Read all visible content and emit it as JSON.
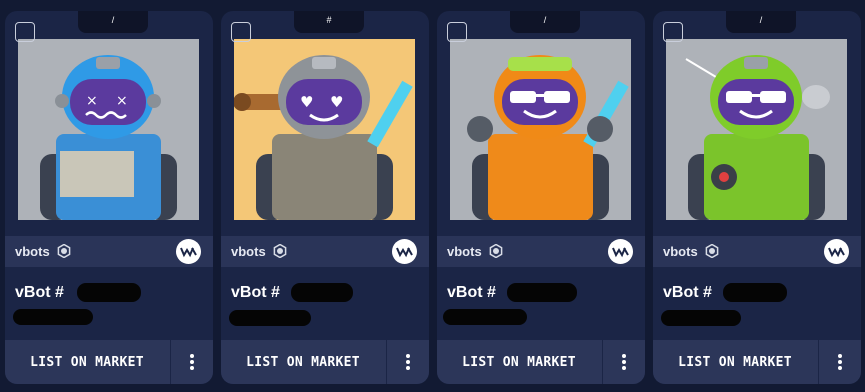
{
  "cards": [
    {
      "notch_symbol": "/",
      "collection": "vbots",
      "title": "vBot #",
      "list_label": "LIST ON MARKET",
      "helmet_color": "#2f9ae6",
      "body_color": "#3a8fd6",
      "background_color": "#aeb2b8",
      "expression": "dizzy"
    },
    {
      "notch_symbol": "#",
      "collection": "vbots",
      "title": "vBot #",
      "list_label": "LIST ON MARKET",
      "helmet_color": "#8e9398",
      "body_color": "#8a8577",
      "background_color": "#f4c777",
      "expression": "heart-eyes"
    },
    {
      "notch_symbol": "/",
      "collection": "vbots",
      "title": "vBot #",
      "list_label": "LIST ON MARKET",
      "helmet_color": "#f08a17",
      "body_color": "#ef8a1a",
      "background_color": "#aeb2b8",
      "expression": "sunglasses"
    },
    {
      "notch_symbol": "/",
      "collection": "vbots",
      "title": "vBot #",
      "list_label": "LIST ON MARKET",
      "helmet_color": "#7fcc2a",
      "body_color": "#7bc42b",
      "background_color": "#aeb2b8",
      "expression": "sunglasses"
    }
  ],
  "icons": {
    "verified": "verified-badge-icon",
    "wax": "wax-logo-icon",
    "more": "more-vertical-icon"
  },
  "colors": {
    "page_bg": "#121a33",
    "card_bg": "#1b2546",
    "bar_bg": "#2c3659"
  }
}
